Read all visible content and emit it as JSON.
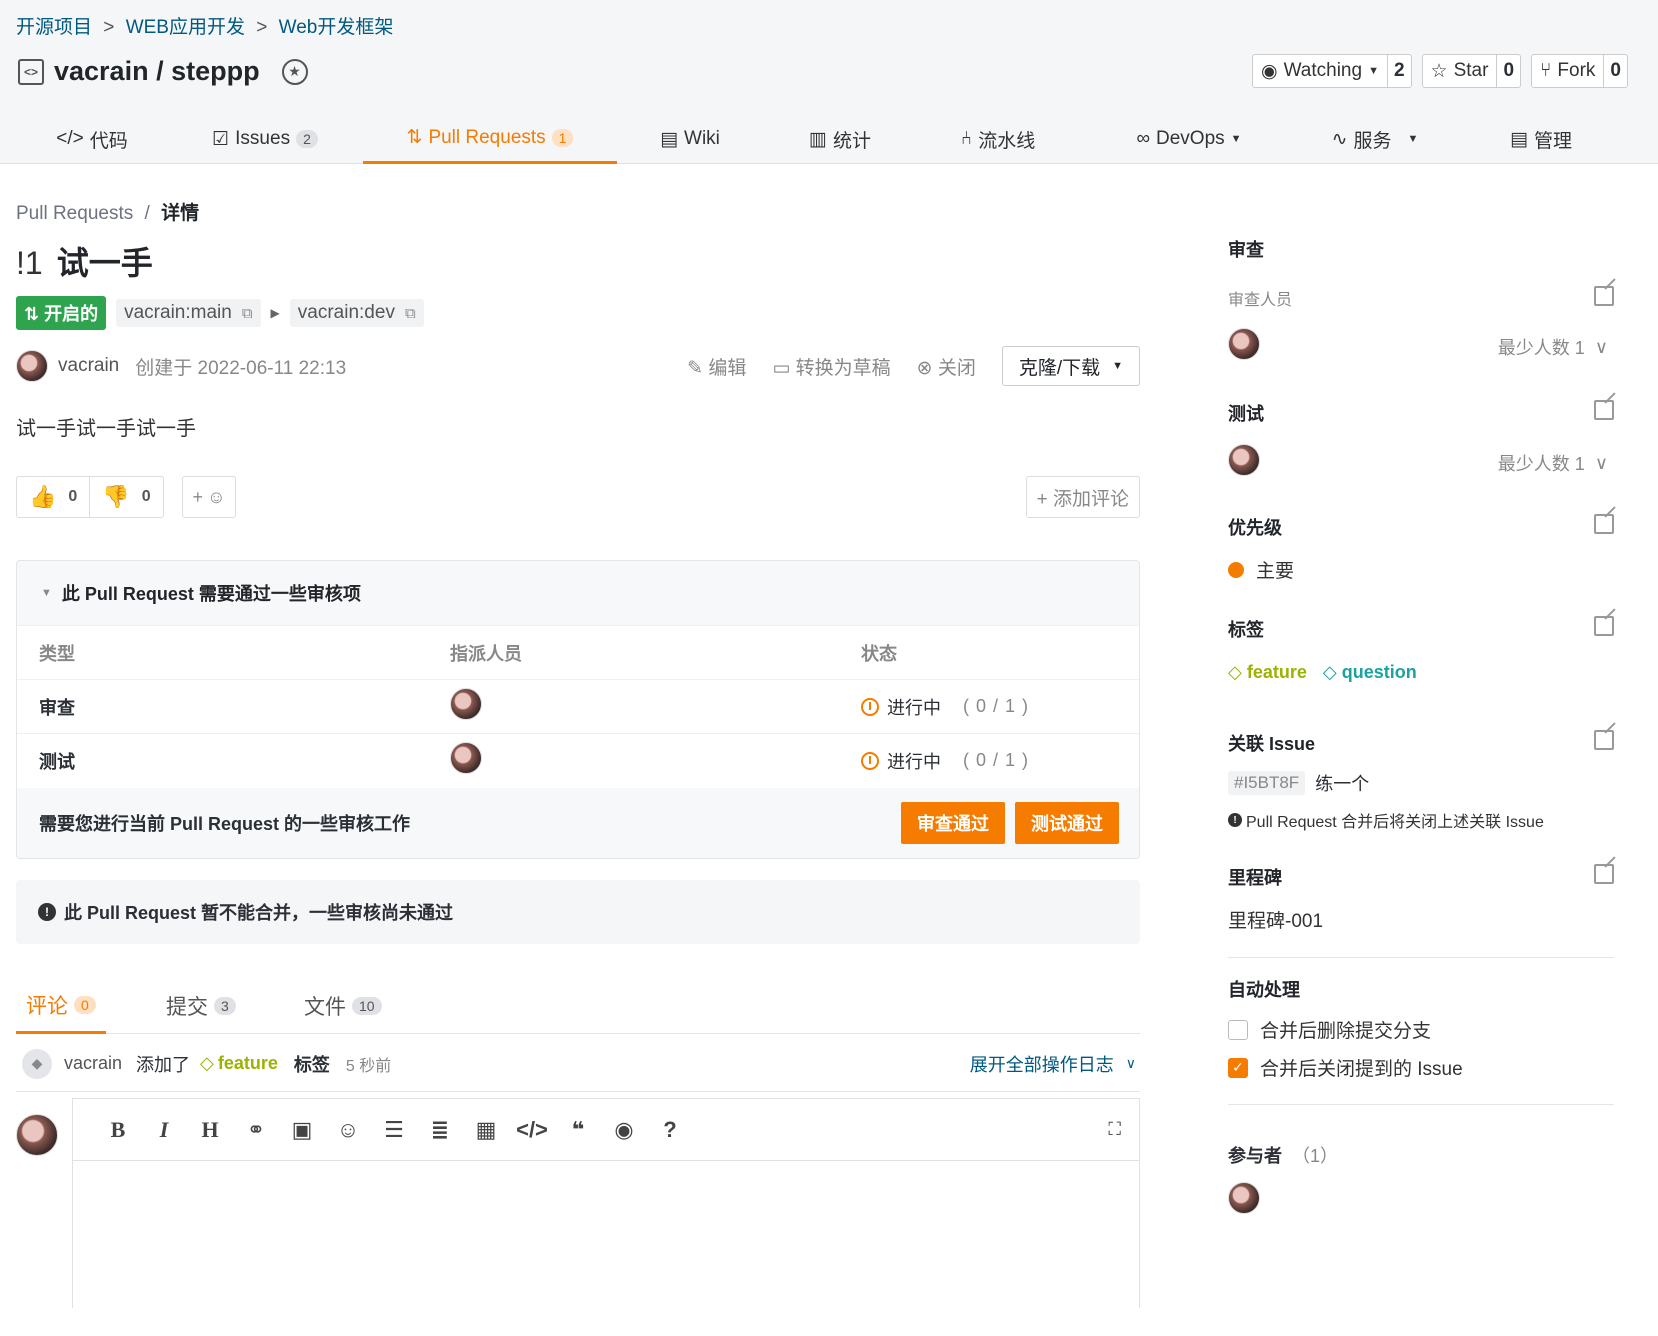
{
  "breadcrumb": {
    "items": [
      "开源项目",
      "WEB应用开发",
      "Web开发框架"
    ],
    "sep": ">"
  },
  "repo": {
    "title": "vacrain / steppp",
    "icon": "code-icon",
    "badge_icon": "award-icon"
  },
  "repo_buttons": {
    "watch": {
      "label": "Watching",
      "count": "2"
    },
    "star": {
      "label": "Star",
      "count": "0"
    },
    "fork": {
      "label": "Fork",
      "count": "0"
    }
  },
  "tabs": [
    {
      "label": "代码",
      "icon": "code-icon"
    },
    {
      "label": "Issues",
      "count": "2",
      "icon": "issues-icon"
    },
    {
      "label": "Pull Requests",
      "count": "1",
      "icon": "pull-request-icon"
    },
    {
      "label": "Wiki",
      "icon": "book-icon"
    },
    {
      "label": "统计",
      "icon": "bar-chart-icon"
    },
    {
      "label": "流水线",
      "icon": "pipeline-icon"
    },
    {
      "label": "DevOps",
      "icon": "infinity-icon"
    },
    {
      "label": "服务",
      "icon": "pulse-icon"
    },
    {
      "label": "管理",
      "icon": "document-icon"
    }
  ],
  "pr": {
    "crumb_root": "Pull Requests",
    "crumb_sep": "/",
    "crumb_leaf": "详情",
    "number": "!1",
    "title": "试一手",
    "state": "开启的",
    "source_branch": "vacrain:main",
    "target_branch": "vacrain:dev",
    "author": "vacrain",
    "created": "创建于 2022-06-11 22:13",
    "actions": {
      "edit": "编辑",
      "draft": "转换为草稿",
      "close": "关闭",
      "clone": "克隆/下载"
    },
    "description": "试一手试一手试一手",
    "reactions": {
      "up": "0",
      "down": "0",
      "add": "+"
    },
    "add_comment": "+ 添加评论"
  },
  "checks": {
    "title": "此 Pull Request 需要通过一些审核项",
    "columns": [
      "类型",
      "指派人员",
      "状态"
    ],
    "rows": [
      {
        "type": "审查",
        "status": "进行中",
        "progress": "( 0 / 1 )"
      },
      {
        "type": "测试",
        "status": "进行中",
        "progress": "( 0 / 1 )"
      }
    ],
    "footer": "需要您进行当前 Pull Request 的一些审核工作",
    "approve_review": "审查通过",
    "approve_test": "测试通过"
  },
  "merge_note": "此 Pull Request 暂不能合并，一些审核尚未通过",
  "subtabs": [
    {
      "label": "评论",
      "count": "0"
    },
    {
      "label": "提交",
      "count": "3"
    },
    {
      "label": "文件",
      "count": "10"
    }
  ],
  "log": {
    "who": "vacrain",
    "action": "添加了",
    "tag": "feature",
    "tag_word": "标签",
    "ago": "5 秒前",
    "expand": "展开全部操作日志"
  },
  "sidebar": {
    "review": {
      "title": "审查",
      "sub": "审查人员",
      "min": "最少人数 1"
    },
    "test": {
      "title": "测试",
      "min": "最少人数 1"
    },
    "priority": {
      "title": "优先级",
      "value": "主要",
      "color": "#f57c00"
    },
    "labels": {
      "title": "标签",
      "items": [
        "feature",
        "question"
      ]
    },
    "issue": {
      "title": "关联 Issue",
      "code": "#I5BT8F",
      "name": "练一个",
      "note": "Pull Request 合并后将关闭上述关联 Issue"
    },
    "milestone": {
      "title": "里程碑",
      "value": "里程碑-001"
    },
    "auto": {
      "title": "自动处理",
      "opt1": "合并后删除提交分支",
      "opt2": "合并后关闭提到的 Issue"
    },
    "participants": {
      "title": "参与者",
      "count": "（1）"
    }
  },
  "colors": {
    "accent": "#f57c00",
    "open": "#2ea44f",
    "link": "#005980"
  }
}
